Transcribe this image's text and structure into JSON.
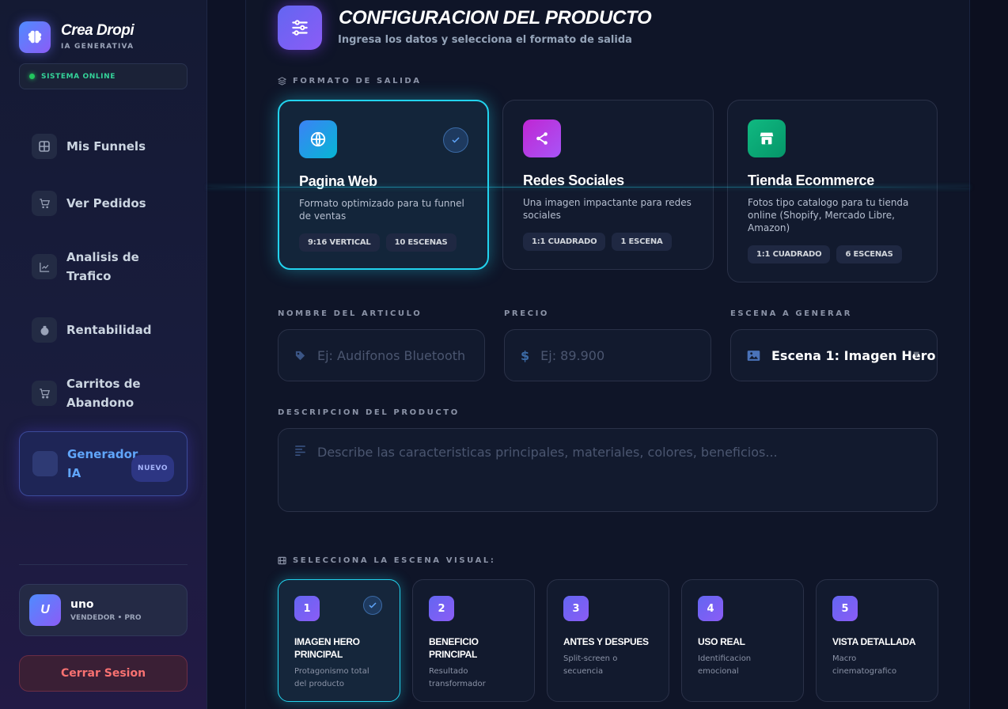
{
  "sidebar": {
    "brand": "Crea Dropi",
    "brand_sub": "IA GENERATIVA",
    "status": "SISTEMA ONLINE",
    "items": [
      {
        "label": "Mis Funnels"
      },
      {
        "label": "Ver Pedidos"
      },
      {
        "label": "Analisis de Trafico"
      },
      {
        "label": "Rentabilidad"
      },
      {
        "label": "Carritos de Abandono"
      },
      {
        "label": "Generador IA",
        "badge": "NUEVO"
      }
    ],
    "user": {
      "initial": "U",
      "name": "uno",
      "role": "VENDEDOR • PRO"
    },
    "logout": "Cerrar Sesion"
  },
  "header": {
    "title": "CONFIGURACION DEL PRODUCTO",
    "subtitle": "Ingresa los datos y selecciona el formato de salida"
  },
  "format": {
    "label": "FORMATO DE SALIDA",
    "options": [
      {
        "title": "Pagina Web",
        "desc": "Formato optimizado para tu funnel de ventas",
        "tags": [
          "9:16 VERTICAL",
          "10 ESCENAS"
        ],
        "selected": true,
        "color": "#3b82f6"
      },
      {
        "title": "Redes Sociales",
        "desc": "Una imagen impactante para redes sociales",
        "tags": [
          "1:1 CUADRADO",
          "1 ESCENA"
        ],
        "selected": false,
        "color": "#c026d3"
      },
      {
        "title": "Tienda Ecommerce",
        "desc": "Fotos tipo catalogo para tu tienda online (Shopify, Mercado Libre, Amazon)",
        "tags": [
          "1:1 CUADRADO",
          "6 ESCENAS"
        ],
        "selected": false,
        "color": "#10b981"
      }
    ]
  },
  "fields": {
    "name_label": "NOMBRE DEL ARTICULO",
    "name_placeholder": "Ej: Audifonos Bluetooth",
    "price_label": "PRECIO",
    "price_placeholder": "Ej: 89.900",
    "scene_label": "ESCENA A GENERAR",
    "scene_value": "Escena 1: Imagen Hero",
    "desc_label": "DESCRIPCION DEL PRODUCTO",
    "desc_placeholder": "Describe las caracteristicas principales, materiales, colores, beneficios..."
  },
  "scenes": {
    "label": "SELECCIONA LA ESCENA VISUAL:",
    "items": [
      {
        "num": "1",
        "title": "IMAGEN HERO PRINCIPAL",
        "desc": "Protagonismo total del producto",
        "selected": true
      },
      {
        "num": "2",
        "title": "BENEFICIO PRINCIPAL",
        "desc": "Resultado transformador",
        "selected": false
      },
      {
        "num": "3",
        "title": "ANTES Y DESPUES",
        "desc": "Split-screen o secuencia",
        "selected": false
      },
      {
        "num": "4",
        "title": "USO REAL",
        "desc": "Identificacion emocional",
        "selected": false
      },
      {
        "num": "5",
        "title": "VISTA DETALLADA",
        "desc": "Macro cinematografico",
        "selected": false
      }
    ]
  },
  "colors": {
    "accent": "#22d3ee",
    "primary": "#6366f1",
    "online": "#22c55e",
    "danger": "#f87171"
  }
}
